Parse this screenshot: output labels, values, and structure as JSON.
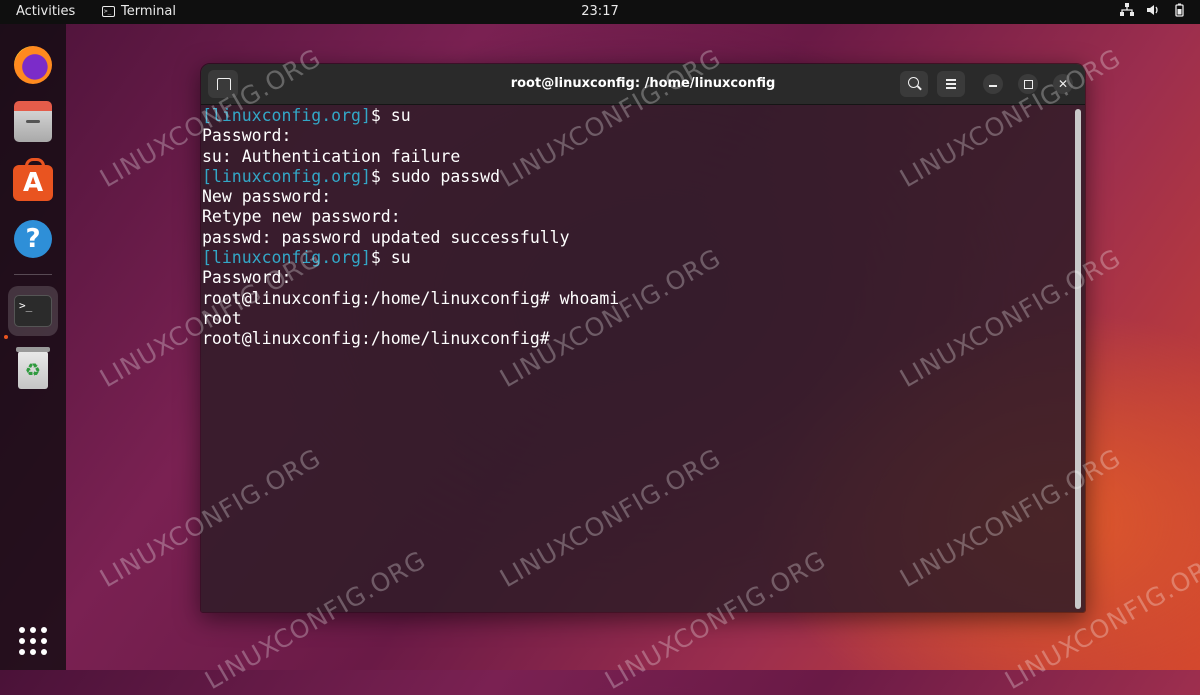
{
  "topbar": {
    "activities": "Activities",
    "app_name": "Terminal",
    "clock": "23:17"
  },
  "dock": {
    "items": [
      {
        "name": "firefox"
      },
      {
        "name": "files"
      },
      {
        "name": "software-center"
      },
      {
        "name": "help"
      },
      {
        "name": "terminal",
        "active": true
      },
      {
        "name": "trash"
      }
    ]
  },
  "window": {
    "title": "root@linuxconfig: /home/linuxconfig"
  },
  "terminal": {
    "lines": [
      {
        "prompt": "[linuxconfig.org]",
        "text": "$ su"
      },
      {
        "prompt": "",
        "text": "Password:"
      },
      {
        "prompt": "",
        "text": "su: Authentication failure"
      },
      {
        "prompt": "[linuxconfig.org]",
        "text": "$ sudo passwd"
      },
      {
        "prompt": "",
        "text": "New password:"
      },
      {
        "prompt": "",
        "text": "Retype new password:"
      },
      {
        "prompt": "",
        "text": "passwd: password updated successfully"
      },
      {
        "prompt": "[linuxconfig.org]",
        "text": "$ su"
      },
      {
        "prompt": "",
        "text": "Password:"
      },
      {
        "prompt": "",
        "text": "root@linuxconfig:/home/linuxconfig# whoami"
      },
      {
        "prompt": "",
        "text": "root"
      },
      {
        "prompt": "",
        "text": "root@linuxconfig:/home/linuxconfig#"
      }
    ]
  },
  "watermark": "LINUXCONFIG.ORG",
  "colors": {
    "prompt": "#33a7c7",
    "accent": "#e95420"
  }
}
